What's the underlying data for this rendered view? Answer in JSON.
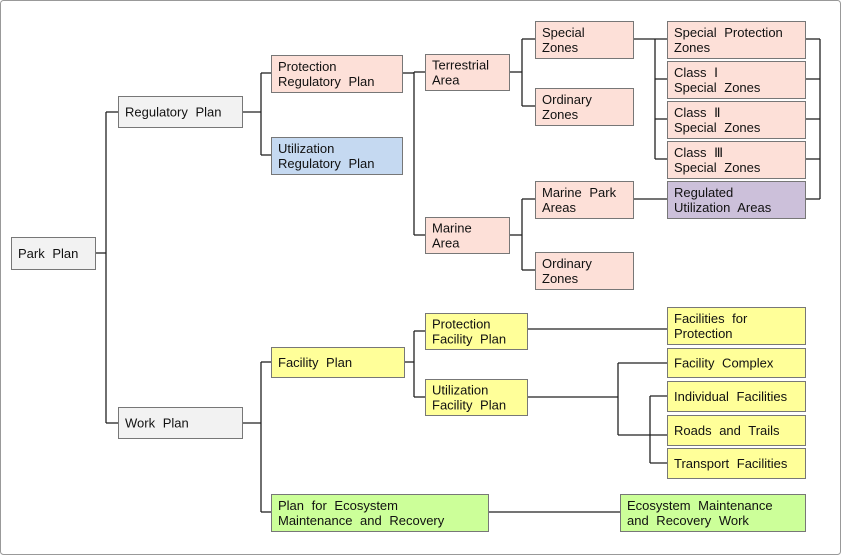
{
  "colors": {
    "root": "#f2f2f2",
    "regulatory": "#fde0d8",
    "utilization_regulatory": "#c5d9f1",
    "regulated_utilization": "#ccc0da",
    "facility": "#ffff99",
    "ecosystem": "#ccff99",
    "line": "#222222"
  },
  "nodes": [
    {
      "id": "park-plan",
      "lines": [
        "Park Plan"
      ],
      "color": "root"
    },
    {
      "id": "regulatory-plan",
      "lines": [
        "Regulatory Plan"
      ],
      "color": "root"
    },
    {
      "id": "work-plan",
      "lines": [
        "Work  Plan"
      ],
      "color": "root"
    },
    {
      "id": "protection-regulatory-plan",
      "lines": [
        "Protection",
        "Regulatory Plan"
      ],
      "color": "regulatory"
    },
    {
      "id": "utilization-regulatory-plan",
      "lines": [
        "Utilization",
        "Regulatory Plan"
      ],
      "color": "utilization_regulatory"
    },
    {
      "id": "terrestrial-area",
      "lines": [
        "Terrestrial",
        "Area"
      ],
      "color": "regulatory"
    },
    {
      "id": "marine-area",
      "lines": [
        "Marine",
        "Area"
      ],
      "color": "regulatory"
    },
    {
      "id": "special-zones",
      "lines": [
        "Special",
        "Zones"
      ],
      "color": "regulatory"
    },
    {
      "id": "ordinary-zones-terrestrial",
      "lines": [
        "Ordinary",
        "Zones"
      ],
      "color": "regulatory"
    },
    {
      "id": "marine-park-areas",
      "lines": [
        "Marine Park",
        "Areas"
      ],
      "color": "regulatory"
    },
    {
      "id": "ordinary-zones-marine",
      "lines": [
        "Ordinary",
        "Zones"
      ],
      "color": "regulatory"
    },
    {
      "id": "special-protection-zones",
      "lines": [
        "Special Protection",
        "Zones"
      ],
      "color": "regulatory"
    },
    {
      "id": "class-1-special-zones",
      "lines": [
        "Class Ⅰ",
        "Special Zones"
      ],
      "color": "regulatory"
    },
    {
      "id": "class-2-special-zones",
      "lines": [
        "Class Ⅱ",
        "Special Zones"
      ],
      "color": "regulatory"
    },
    {
      "id": "class-3-special-zones",
      "lines": [
        "Class Ⅲ",
        "Special Zones"
      ],
      "color": "regulatory"
    },
    {
      "id": "regulated-utilization-areas",
      "lines": [
        "Regulated",
        "Utilization Areas"
      ],
      "color": "regulated_utilization"
    },
    {
      "id": "facility-plan",
      "lines": [
        "Facility Plan"
      ],
      "color": "facility"
    },
    {
      "id": "protection-facility-plan",
      "lines": [
        "Protection",
        "Facility Plan"
      ],
      "color": "facility"
    },
    {
      "id": "utilization-facility-plan",
      "lines": [
        "Utilization",
        "Facility Plan"
      ],
      "color": "facility"
    },
    {
      "id": "facilities-for-protection",
      "lines": [
        "Facilities for",
        "Protection"
      ],
      "color": "facility"
    },
    {
      "id": "facility-complex",
      "lines": [
        "Facility Complex"
      ],
      "color": "facility"
    },
    {
      "id": "individual-facilities",
      "lines": [
        "Individual Facilities"
      ],
      "color": "facility"
    },
    {
      "id": "roads-and-trails",
      "lines": [
        "Roads and Trails"
      ],
      "color": "facility"
    },
    {
      "id": "transport-facilities",
      "lines": [
        "Transport Facilities"
      ],
      "color": "facility"
    },
    {
      "id": "plan-for-ecosystem",
      "lines": [
        "Plan for Ecosystem",
        "Maintenance and Recovery"
      ],
      "color": "ecosystem"
    },
    {
      "id": "ecosystem-maintenance-work",
      "lines": [
        "Ecosystem Maintenance",
        "and Recovery Work"
      ],
      "color": "ecosystem"
    }
  ]
}
